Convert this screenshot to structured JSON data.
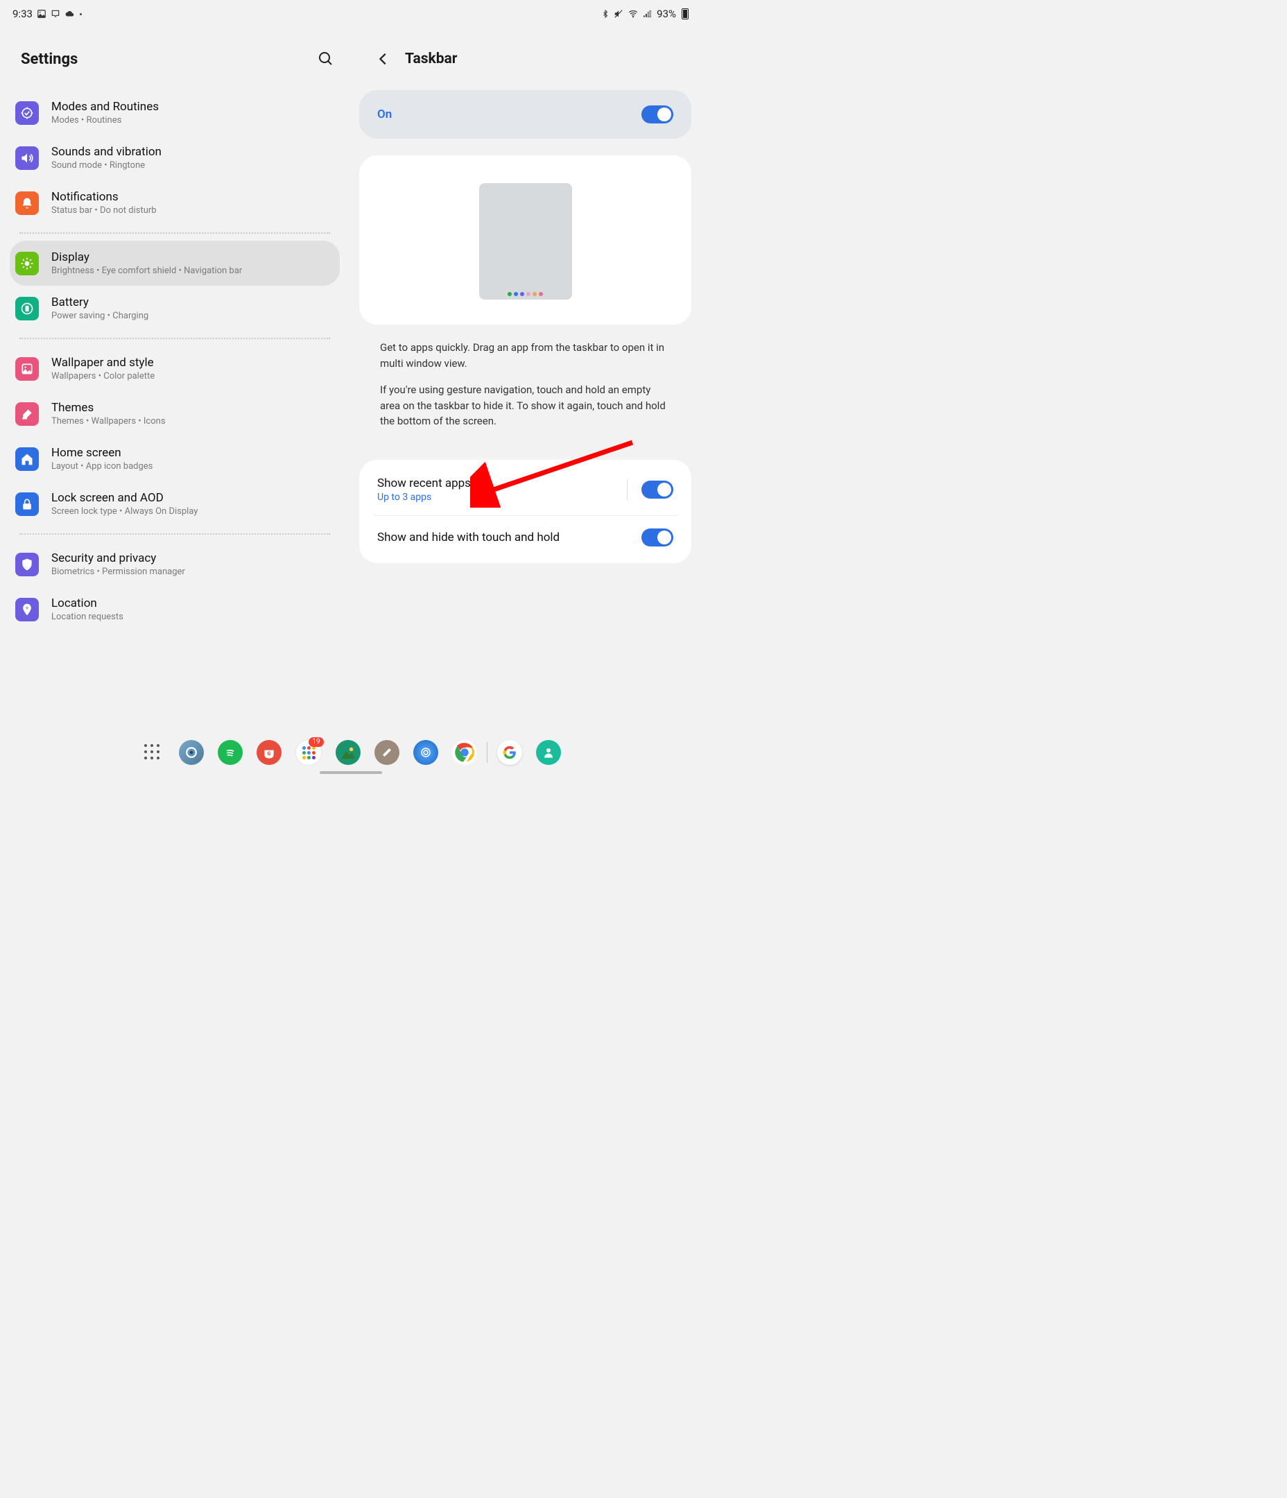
{
  "status": {
    "time": "9:33",
    "battery": "93%"
  },
  "left": {
    "title": "Settings",
    "items": [
      {
        "title": "Modes and Routines",
        "sub": "Modes  •  Routines",
        "color": "#6b5ce0",
        "icon": "target"
      },
      {
        "title": "Sounds and vibration",
        "sub": "Sound mode  •  Ringtone",
        "color": "#6b5ce0",
        "icon": "speaker"
      },
      {
        "title": "Notifications",
        "sub": "Status bar  •  Do not disturb",
        "color": "#f0662e",
        "icon": "bell"
      },
      {
        "title": "Display",
        "sub": "Brightness  •  Eye comfort shield  •  Navigation bar",
        "color": "#6abf15",
        "icon": "sun",
        "selected": true
      },
      {
        "title": "Battery",
        "sub": "Power saving  •  Charging",
        "color": "#0fb083",
        "icon": "battery"
      },
      {
        "title": "Wallpaper and style",
        "sub": "Wallpapers  •  Color palette",
        "color": "#e8547c",
        "icon": "image"
      },
      {
        "title": "Themes",
        "sub": "Themes  •  Wallpapers  •  Icons",
        "color": "#e8547c",
        "icon": "brush"
      },
      {
        "title": "Home screen",
        "sub": "Layout  •  App icon badges",
        "color": "#2d6fe3",
        "icon": "home"
      },
      {
        "title": "Lock screen and AOD",
        "sub": "Screen lock type  •  Always On Display",
        "color": "#2d6fe3",
        "icon": "lock"
      },
      {
        "title": "Security and privacy",
        "sub": "Biometrics  •  Permission manager",
        "color": "#6b5ce0",
        "icon": "shield"
      },
      {
        "title": "Location",
        "sub": "Location requests",
        "color": "#6b5ce0",
        "icon": "pin"
      }
    ]
  },
  "right": {
    "title": "Taskbar",
    "on_label": "On",
    "desc1": "Get to apps quickly. Drag an app from the taskbar to open it in multi window view.",
    "desc2": "If you're using gesture navigation, touch and hold an empty area on the taskbar to hide it. To show it again, touch and hold the bottom of the screen.",
    "opt1_title": "Show recent apps",
    "opt1_sub": "Up to 3 apps",
    "opt2_title": "Show and hide with touch and hold"
  },
  "dock": {
    "badge": "19"
  }
}
